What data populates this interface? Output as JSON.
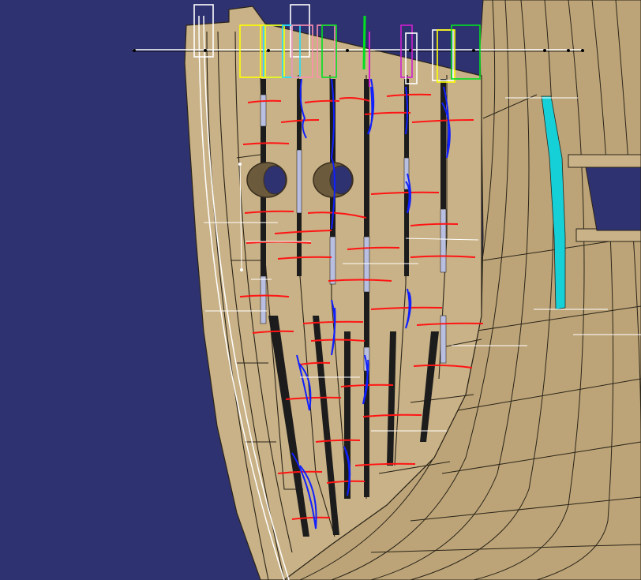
{
  "colors": {
    "background": "#2f3270",
    "hull_plank": "#c9b287",
    "hull_plank_dark": "#bca478",
    "plank_seam": "#2a2418",
    "slot_gap": "#1c1c1c",
    "slot_fill_light": "#b8bfe0",
    "highlight_plank": "#16d0d8",
    "port_hole_inner": "#6b5a3c",
    "port_hole_shadow": "#3a2f1e",
    "sketch_red": "#ff1414",
    "sketch_blue": "#1020ff",
    "dimension_line": "#ffffff",
    "box_yellow": "#ffff00",
    "box_cyan": "#20e0ff",
    "box_green": "#00e020",
    "box_magenta": "#d020d0",
    "box_pink": "#ff90b0",
    "box_white": "#ffffff"
  },
  "scene": {
    "description_icons": [
      "hull-plank-icon",
      "port-hole-icon",
      "bounding-box-icon",
      "sketch-stroke-icon",
      "dimension-line-icon"
    ]
  }
}
